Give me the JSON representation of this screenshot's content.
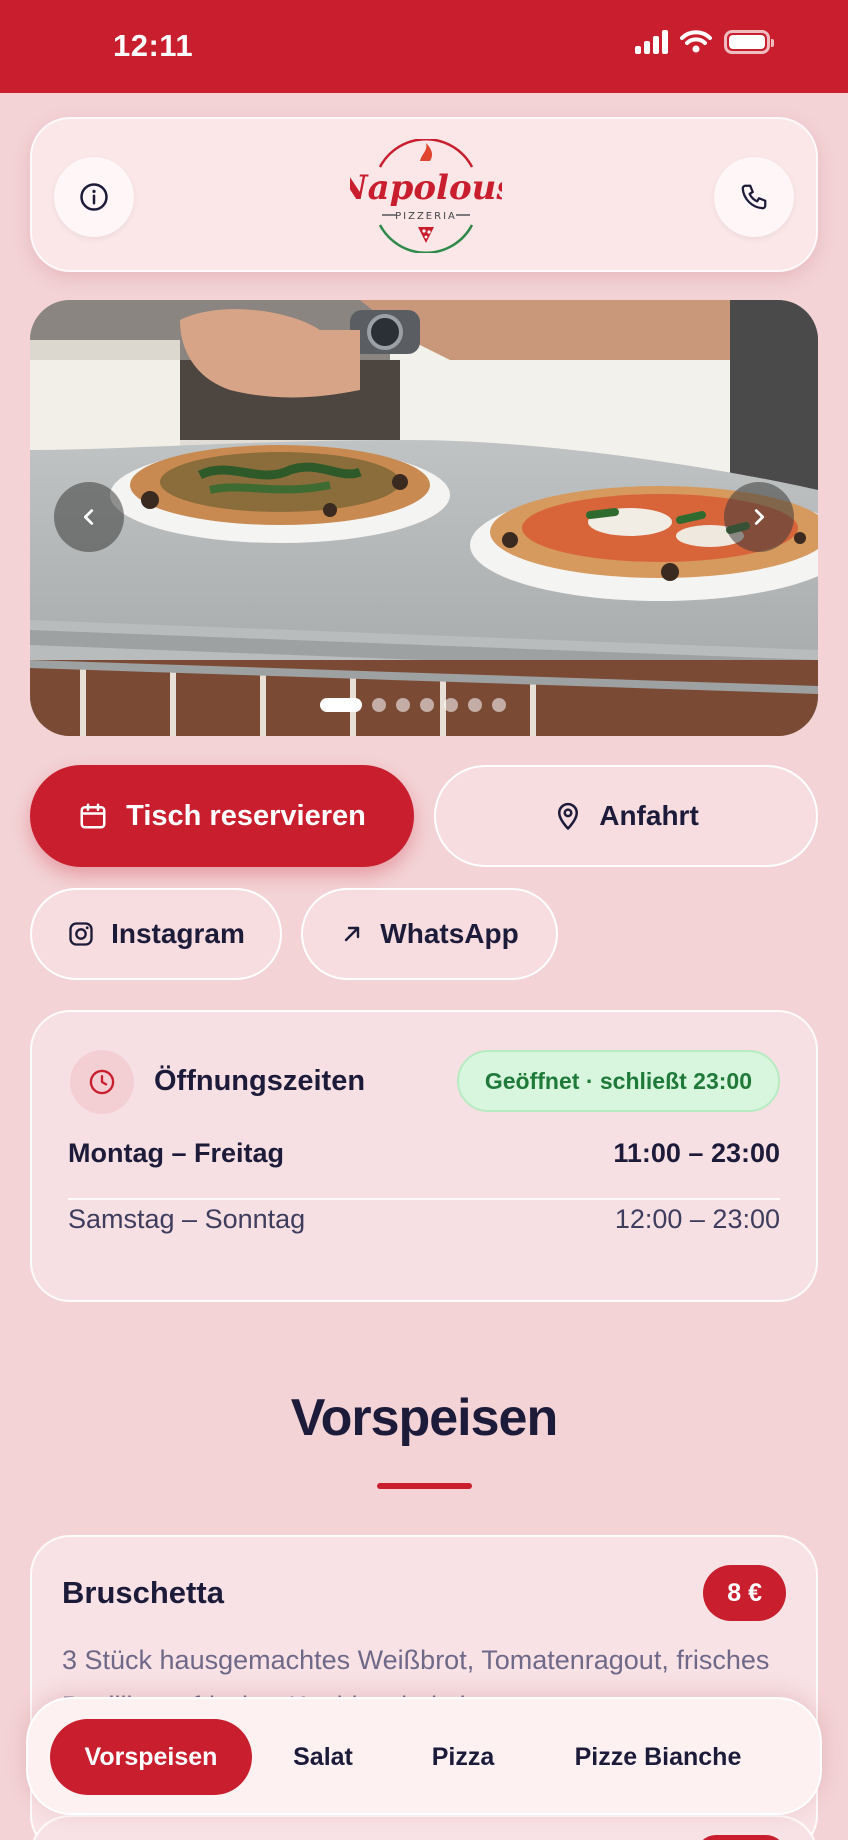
{
  "status": {
    "time": "12:11"
  },
  "header": {
    "logo_text": "Napolous",
    "logo_sub": "PIZZERIA",
    "info_icon": "info-icon",
    "phone_icon": "phone-icon"
  },
  "carousel": {
    "slide_count": 7,
    "active_index": 0
  },
  "actions": {
    "reserve_label": "Tisch reservieren",
    "directions_label": "Anfahrt",
    "instagram_label": "Instagram",
    "whatsapp_label": "WhatsApp"
  },
  "hours": {
    "title": "Öffnungszeiten",
    "status_badge": "Geöffnet · schließt 23:00",
    "rows": [
      {
        "days": "Montag – Freitag",
        "time": "11:00 – 23:00"
      },
      {
        "days": "Samstag – Sonntag",
        "time": "12:00 – 23:00"
      }
    ]
  },
  "section": {
    "title": "Vorspeisen"
  },
  "items": [
    {
      "name": "Bruschetta",
      "price": "8 €",
      "description": "3 Stück hausgemachtes Weißbrot, Tomatenragout, frisches Basilikum, frischer Knoblauch, kaltgepresstes"
    }
  ],
  "categories": [
    {
      "label": "Vorspeisen",
      "active": true
    },
    {
      "label": "Salat",
      "active": false
    },
    {
      "label": "Pizza",
      "active": false
    },
    {
      "label": "Pizze Bianche",
      "active": false
    }
  ],
  "colors": {
    "brand": "#c81e2d",
    "background": "#f3d3d6",
    "open_badge": "#d8f6de",
    "open_text": "#1f7a3a"
  }
}
